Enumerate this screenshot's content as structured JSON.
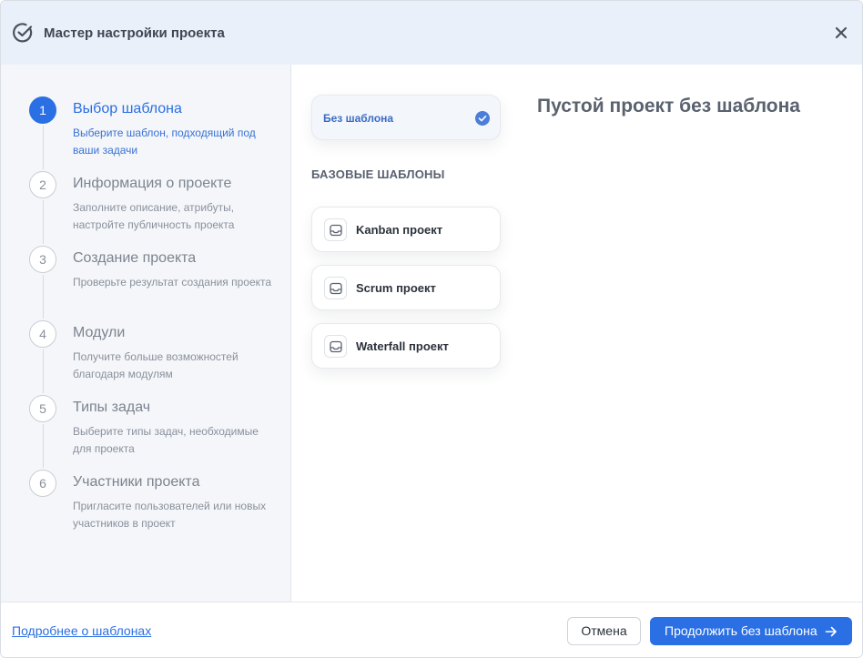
{
  "header": {
    "title": "Мастер настройки проекта",
    "icon": "check-circle-icon",
    "close_icon": "close-icon"
  },
  "steps": [
    {
      "number": "1",
      "title": "Выбор шаблона",
      "description": "Выберите шаблон, подходящий под ваши задачи",
      "active": true
    },
    {
      "number": "2",
      "title": "Информация о проекте",
      "description": "Заполните описание, атрибуты, настройте публичность проекта",
      "active": false
    },
    {
      "number": "3",
      "title": "Создание проекта",
      "description": "Проверьте результат создания проекта",
      "active": false
    },
    {
      "number": "4",
      "title": "Модули",
      "description": "Получите больше возможностей благодаря модулям",
      "active": false
    },
    {
      "number": "5",
      "title": "Типы задач",
      "description": "Выберите типы задач, необходимые для проекта",
      "active": false
    },
    {
      "number": "6",
      "title": "Участники проекта",
      "description": "Пригласите пользователей или новых участников в проект",
      "active": false
    }
  ],
  "templates": {
    "no_template_label": "Без шаблона",
    "section_title": "БАЗОВЫЕ ШАБЛОНЫ",
    "items": [
      {
        "label": "Kanban проект",
        "icon": "inbox-icon"
      },
      {
        "label": "Scrum проект",
        "icon": "inbox-icon"
      },
      {
        "label": "Waterfall проект",
        "icon": "inbox-icon"
      }
    ]
  },
  "preview": {
    "title": "Пустой проект без шаблона"
  },
  "footer": {
    "link": "Подробнее о шаблонах",
    "cancel_label": "Отмена",
    "continue_label": "Продолжить без шаблона"
  },
  "colors": {
    "accent": "#2a6fe4",
    "header_bg": "#eaf0f9",
    "sidebar_bg": "#f4f6fa"
  }
}
